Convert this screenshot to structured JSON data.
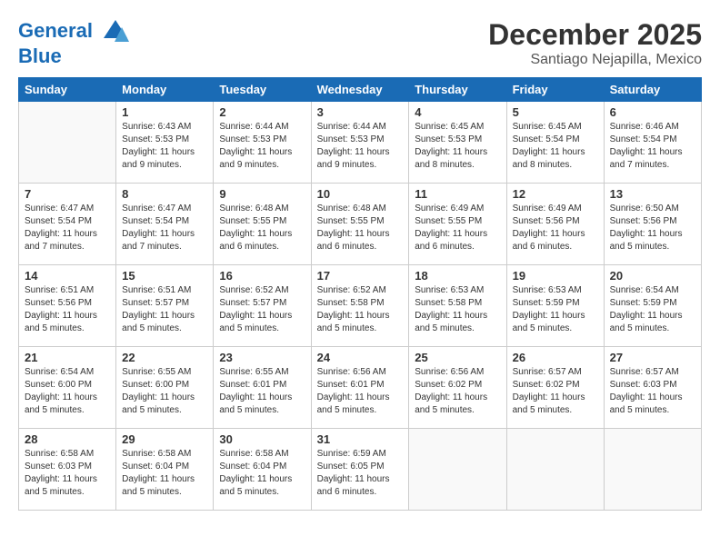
{
  "header": {
    "logo_line1": "General",
    "logo_line2": "Blue",
    "month": "December 2025",
    "location": "Santiago Nejapilla, Mexico"
  },
  "weekdays": [
    "Sunday",
    "Monday",
    "Tuesday",
    "Wednesday",
    "Thursday",
    "Friday",
    "Saturday"
  ],
  "weeks": [
    [
      {
        "day": "",
        "info": ""
      },
      {
        "day": "1",
        "info": "Sunrise: 6:43 AM\nSunset: 5:53 PM\nDaylight: 11 hours\nand 9 minutes."
      },
      {
        "day": "2",
        "info": "Sunrise: 6:44 AM\nSunset: 5:53 PM\nDaylight: 11 hours\nand 9 minutes."
      },
      {
        "day": "3",
        "info": "Sunrise: 6:44 AM\nSunset: 5:53 PM\nDaylight: 11 hours\nand 9 minutes."
      },
      {
        "day": "4",
        "info": "Sunrise: 6:45 AM\nSunset: 5:53 PM\nDaylight: 11 hours\nand 8 minutes."
      },
      {
        "day": "5",
        "info": "Sunrise: 6:45 AM\nSunset: 5:54 PM\nDaylight: 11 hours\nand 8 minutes."
      },
      {
        "day": "6",
        "info": "Sunrise: 6:46 AM\nSunset: 5:54 PM\nDaylight: 11 hours\nand 7 minutes."
      }
    ],
    [
      {
        "day": "7",
        "info": "Sunrise: 6:47 AM\nSunset: 5:54 PM\nDaylight: 11 hours\nand 7 minutes."
      },
      {
        "day": "8",
        "info": "Sunrise: 6:47 AM\nSunset: 5:54 PM\nDaylight: 11 hours\nand 7 minutes."
      },
      {
        "day": "9",
        "info": "Sunrise: 6:48 AM\nSunset: 5:55 PM\nDaylight: 11 hours\nand 6 minutes."
      },
      {
        "day": "10",
        "info": "Sunrise: 6:48 AM\nSunset: 5:55 PM\nDaylight: 11 hours\nand 6 minutes."
      },
      {
        "day": "11",
        "info": "Sunrise: 6:49 AM\nSunset: 5:55 PM\nDaylight: 11 hours\nand 6 minutes."
      },
      {
        "day": "12",
        "info": "Sunrise: 6:49 AM\nSunset: 5:56 PM\nDaylight: 11 hours\nand 6 minutes."
      },
      {
        "day": "13",
        "info": "Sunrise: 6:50 AM\nSunset: 5:56 PM\nDaylight: 11 hours\nand 5 minutes."
      }
    ],
    [
      {
        "day": "14",
        "info": "Sunrise: 6:51 AM\nSunset: 5:56 PM\nDaylight: 11 hours\nand 5 minutes."
      },
      {
        "day": "15",
        "info": "Sunrise: 6:51 AM\nSunset: 5:57 PM\nDaylight: 11 hours\nand 5 minutes."
      },
      {
        "day": "16",
        "info": "Sunrise: 6:52 AM\nSunset: 5:57 PM\nDaylight: 11 hours\nand 5 minutes."
      },
      {
        "day": "17",
        "info": "Sunrise: 6:52 AM\nSunset: 5:58 PM\nDaylight: 11 hours\nand 5 minutes."
      },
      {
        "day": "18",
        "info": "Sunrise: 6:53 AM\nSunset: 5:58 PM\nDaylight: 11 hours\nand 5 minutes."
      },
      {
        "day": "19",
        "info": "Sunrise: 6:53 AM\nSunset: 5:59 PM\nDaylight: 11 hours\nand 5 minutes."
      },
      {
        "day": "20",
        "info": "Sunrise: 6:54 AM\nSunset: 5:59 PM\nDaylight: 11 hours\nand 5 minutes."
      }
    ],
    [
      {
        "day": "21",
        "info": "Sunrise: 6:54 AM\nSunset: 6:00 PM\nDaylight: 11 hours\nand 5 minutes."
      },
      {
        "day": "22",
        "info": "Sunrise: 6:55 AM\nSunset: 6:00 PM\nDaylight: 11 hours\nand 5 minutes."
      },
      {
        "day": "23",
        "info": "Sunrise: 6:55 AM\nSunset: 6:01 PM\nDaylight: 11 hours\nand 5 minutes."
      },
      {
        "day": "24",
        "info": "Sunrise: 6:56 AM\nSunset: 6:01 PM\nDaylight: 11 hours\nand 5 minutes."
      },
      {
        "day": "25",
        "info": "Sunrise: 6:56 AM\nSunset: 6:02 PM\nDaylight: 11 hours\nand 5 minutes."
      },
      {
        "day": "26",
        "info": "Sunrise: 6:57 AM\nSunset: 6:02 PM\nDaylight: 11 hours\nand 5 minutes."
      },
      {
        "day": "27",
        "info": "Sunrise: 6:57 AM\nSunset: 6:03 PM\nDaylight: 11 hours\nand 5 minutes."
      }
    ],
    [
      {
        "day": "28",
        "info": "Sunrise: 6:58 AM\nSunset: 6:03 PM\nDaylight: 11 hours\nand 5 minutes."
      },
      {
        "day": "29",
        "info": "Sunrise: 6:58 AM\nSunset: 6:04 PM\nDaylight: 11 hours\nand 5 minutes."
      },
      {
        "day": "30",
        "info": "Sunrise: 6:58 AM\nSunset: 6:04 PM\nDaylight: 11 hours\nand 5 minutes."
      },
      {
        "day": "31",
        "info": "Sunrise: 6:59 AM\nSunset: 6:05 PM\nDaylight: 11 hours\nand 6 minutes."
      },
      {
        "day": "",
        "info": ""
      },
      {
        "day": "",
        "info": ""
      },
      {
        "day": "",
        "info": ""
      }
    ]
  ]
}
